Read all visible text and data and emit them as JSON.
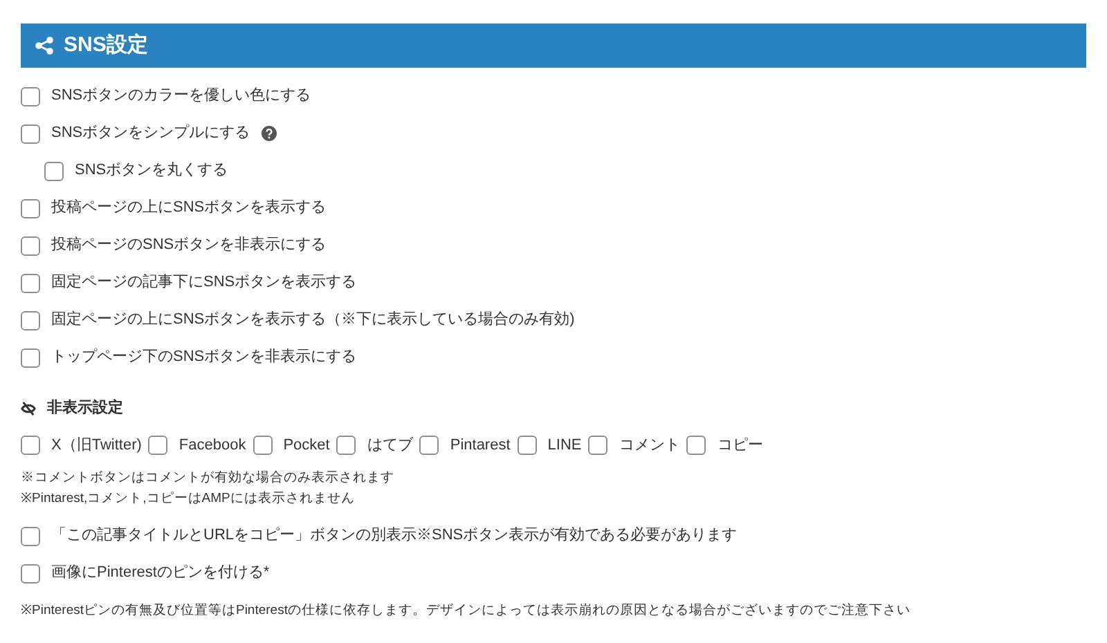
{
  "header": {
    "title": "SNS設定"
  },
  "options": [
    {
      "label": "SNSボタンのカラーを優しい色にする",
      "checked": false,
      "help": false,
      "nested": false
    },
    {
      "label": "SNSボタンをシンプルにする",
      "checked": false,
      "help": true,
      "nested": false
    },
    {
      "label": "SNSボタンを丸くする",
      "checked": false,
      "help": false,
      "nested": true
    },
    {
      "label": "投稿ページの上にSNSボタンを表示する",
      "checked": false,
      "help": false,
      "nested": false
    },
    {
      "label": "投稿ページのSNSボタンを非表示にする",
      "checked": false,
      "help": false,
      "nested": false
    },
    {
      "label": "固定ページの記事下にSNSボタンを表示する",
      "checked": false,
      "help": false,
      "nested": false
    },
    {
      "label": "固定ページの上にSNSボタンを表示する（※下に表示している場合のみ有効)",
      "checked": false,
      "help": false,
      "nested": false
    },
    {
      "label": "トップページ下のSNSボタンを非表示にする",
      "checked": false,
      "help": false,
      "nested": false
    }
  ],
  "hidden_section": {
    "title": "非表示設定",
    "services": [
      {
        "label": "X（旧Twitter)",
        "checked": false
      },
      {
        "label": "Facebook",
        "checked": false
      },
      {
        "label": "Pocket",
        "checked": false
      },
      {
        "label": "はてブ",
        "checked": false
      },
      {
        "label": "Pintarest",
        "checked": false
      },
      {
        "label": "LINE",
        "checked": false
      },
      {
        "label": "コメント",
        "checked": false
      },
      {
        "label": "コピー",
        "checked": false
      }
    ],
    "notes": [
      "※コメントボタンはコメントが有効な場合のみ表示されます",
      "※Pintarest,コメント,コピーはAMPには表示されません"
    ]
  },
  "extra_options": [
    {
      "label": "「この記事タイトルとURLをコピー」ボタンの別表示※SNSボタン表示が有効である必要があります",
      "checked": false
    },
    {
      "label": "画像にPinterestのピンを付ける*",
      "checked": false
    }
  ],
  "footer_note": "※Pinterestピンの有無及び位置等はPinterestの仕様に依存します。デザインによっては表示崩れの原因となる場合がございますのでご注意下さい"
}
